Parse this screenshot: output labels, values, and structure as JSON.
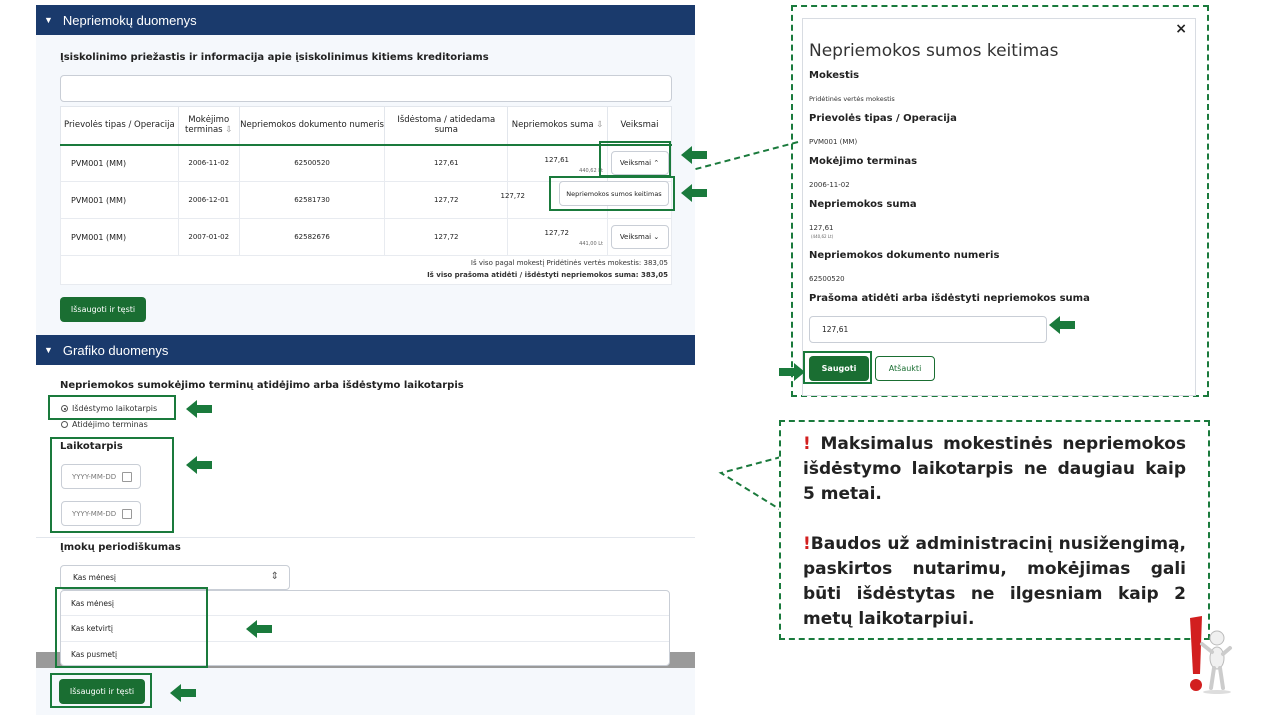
{
  "section1": {
    "title": "Nepriemokų duomenys"
  },
  "reason": {
    "label": "Įsiskolinimo priežastis ir informacija apie įsiskolinimus kitiems kreditoriams",
    "value": ""
  },
  "table": {
    "headers": [
      "Prievolės tipas / Operacija",
      "Mokėjimo terminas",
      "Nepriemokos dokumento numeris",
      "Išdėstoma / atidedama suma",
      "Nepriemokos suma",
      "Veiksmai"
    ],
    "rows": [
      {
        "type": "PVM001 (MM)",
        "term": "2006-11-02",
        "doc": "62500520",
        "amount": "127,61",
        "sum": "127,61",
        "sub": "440,62 Lt",
        "action": "Veiksmai"
      },
      {
        "type": "PVM001 (MM)",
        "term": "2006-12-01",
        "doc": "62581730",
        "amount": "127,72",
        "sum": "127,72",
        "sub": "",
        "action": "Veiksmai"
      },
      {
        "type": "PVM001 (MM)",
        "term": "2007-01-02",
        "doc": "62582676",
        "amount": "127,72",
        "sum": "127,72",
        "sub": "441,00 Lt",
        "action": "Veiksmai"
      }
    ],
    "menu_item": "Nepriemokos sumos keitimas",
    "total1": "Iš viso pagal mokestį Pridėtinės vertės mokestis: 383,05",
    "total2": "Iš viso prašoma atidėti / išdėstyti nepriemokos suma: 383,05"
  },
  "save_button": "Išsaugoti ir tęsti",
  "section2": {
    "title": "Grafiko duomenys"
  },
  "period": {
    "label": "Nepriemokos sumokėjimo terminų atidėjimo arba išdėstymo laikotarpis",
    "option1": "Išdėstymo laikotarpis",
    "option2": "Atidėjimo terminas",
    "laikotarpis": "Laikotarpis",
    "date_placeholder": "YYYY-MM-DD"
  },
  "periodicity": {
    "label": "Įmokų periodiškumas",
    "selected": "Kas mėnesį",
    "options": [
      "Kas mėnesį",
      "Kas ketvirtį",
      "Kas pusmetį"
    ]
  },
  "modal": {
    "title": "Nepriemokos sumos keitimas",
    "close": "×",
    "fields": [
      {
        "label": "Mokestis",
        "value": "Pridėtinės vertės mokestis"
      },
      {
        "label": "Prievolės tipas / Operacija",
        "value": "PVM001 (MM)"
      },
      {
        "label": "Mokėjimo terminas",
        "value": "2006-11-02"
      },
      {
        "label": "Nepriemokos suma",
        "value": "127,61",
        "sub": "(440,62 Lt)"
      },
      {
        "label": "Nepriemokos dokumento numeris",
        "value": "62500520"
      }
    ],
    "input_label": "Prašoma atidėti arba išdėstyti nepriemokos suma",
    "input_value": "127,61",
    "save": "Saugoti",
    "cancel": "Atšaukti"
  },
  "note": {
    "mark": "!",
    "text1": " Maksimalus mokestinės nepriemokos išdėstymo laikotarpis ne daugiau kaip 5 metai.",
    "text2": "Baudos už administracinį nusižengimą, paskirtos nutarimu, mokėjimas gali būti išdėstytas ne ilgesniam kaip 2 metų laikotarpiui."
  },
  "colors": {
    "header": "#1a3a6c",
    "accent": "#1a6e32",
    "highlight": "#1a7a3c",
    "warning": "#d21f1f"
  }
}
